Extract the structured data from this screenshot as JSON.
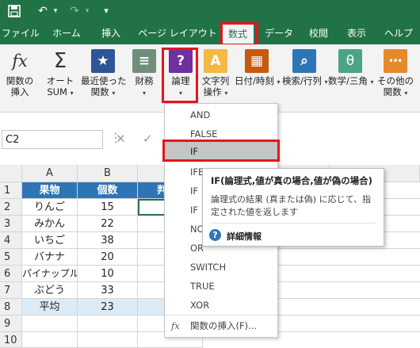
{
  "quick_access": {
    "save_icon": "save-icon",
    "undo_glyph": "↶",
    "redo_glyph": "↷",
    "customize_glyph": "▾"
  },
  "tabs": [
    "ファイル",
    "ホーム",
    "挿入",
    "ページ レイアウト",
    "数式",
    "データ",
    "校閲",
    "表示",
    "ヘルプ"
  ],
  "active_tab": "数式",
  "ribbon": {
    "insert_function": {
      "icon": "fx",
      "label1": "関数の",
      "label2": "挿入"
    },
    "autosum": {
      "icon": "Σ",
      "label1": "オート",
      "label2": "SUM"
    },
    "recent": {
      "icon": "★",
      "label1": "最近使った",
      "label2": "関数"
    },
    "financial": {
      "icon": "≡",
      "label1": "財務"
    },
    "logical": {
      "icon": "?",
      "label1": "論理"
    },
    "text": {
      "icon": "A",
      "label1": "文字列",
      "label2": "操作"
    },
    "datetime": {
      "icon": "▦",
      "label1": "日付/時刻"
    },
    "lookup": {
      "icon": "⌕",
      "label1": "検索/行列"
    },
    "math": {
      "icon": "θ",
      "label1": "数学/三角"
    },
    "more": {
      "icon": "⋯",
      "label1": "その他の",
      "label2": "関数"
    }
  },
  "formula_bar": {
    "name_box": "C2",
    "more_glyph": "⋮",
    "cancel_glyph": "✕",
    "enter_glyph": "✓"
  },
  "sheet": {
    "columns": [
      "A",
      "B",
      "C",
      "D",
      "E",
      "F"
    ],
    "rows": [
      "1",
      "2",
      "3",
      "4",
      "5",
      "6",
      "7",
      "8",
      "9",
      "10"
    ],
    "header": {
      "a": "果物",
      "b": "個数",
      "c_partial": "判"
    },
    "data": [
      {
        "a": "りんご",
        "b": "15"
      },
      {
        "a": "みかん",
        "b": "22"
      },
      {
        "a": "いちご",
        "b": "38"
      },
      {
        "a": "バナナ",
        "b": "20"
      },
      {
        "a": "パイナップル",
        "b": "10"
      },
      {
        "a": "ぶどう",
        "b": "33"
      }
    ],
    "average": {
      "a": "平均",
      "b": "23"
    }
  },
  "dropdown": {
    "items": [
      "AND",
      "FALSE",
      "IF",
      "IFERROR",
      "IFNA",
      "IFS",
      "NOT",
      "OR",
      "SWITCH",
      "TRUE",
      "XOR"
    ],
    "visible_text": [
      "AND",
      "FALSE",
      "IF",
      "IFERROR",
      "IF",
      "IF",
      "NO",
      "OR",
      "SWITCH",
      "TRUE",
      "XOR"
    ],
    "highlighted": "IF",
    "insert_function": "関数の挿入(F)...",
    "insert_icon": "fx"
  },
  "tooltip": {
    "title": "IF(論理式,値が真の場合,値が偽の場合)",
    "line1": "論理式の結果 (真または偽) に応じて、指",
    "line2": "定された値を返します",
    "help_icon": "?",
    "help_label": "詳細情報"
  },
  "colors": {
    "excel_green": "#217346",
    "highlight_red": "#e3161d",
    "header_blue": "#2f75b5",
    "average_fill": "#ddebf7"
  }
}
